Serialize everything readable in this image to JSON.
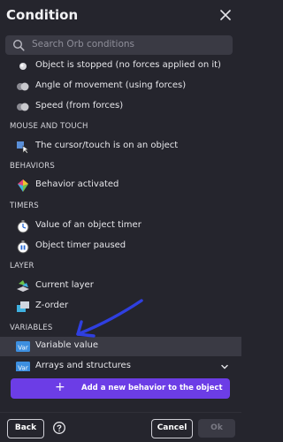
{
  "dialog": {
    "title": "Condition",
    "close_icon": "close-icon"
  },
  "search": {
    "placeholder": "Search Orb conditions",
    "icon": "search-icon"
  },
  "list": {
    "items_top": [
      {
        "label": "Object is stopped (no forces applied on it)",
        "icon": "stopped-icon"
      },
      {
        "label": "Angle of movement (using forces)",
        "icon": "forces-icon"
      },
      {
        "label": "Speed (from forces)",
        "icon": "forces-icon"
      }
    ],
    "groups": [
      {
        "name": "MOUSE AND TOUCH",
        "items": [
          {
            "label": "The cursor/touch is on an object",
            "icon": "cursor-icon"
          }
        ]
      },
      {
        "name": "BEHAVIORS",
        "items": [
          {
            "label": "Behavior activated",
            "icon": "behavior-icon"
          }
        ]
      },
      {
        "name": "TIMERS",
        "items": [
          {
            "label": "Value of an object timer",
            "icon": "timer-icon"
          },
          {
            "label": "Object timer paused",
            "icon": "timer-paused-icon"
          }
        ]
      },
      {
        "name": "LAYER",
        "items": [
          {
            "label": "Current layer",
            "icon": "layer-icon"
          },
          {
            "label": "Z-order",
            "icon": "z-order-icon"
          }
        ]
      },
      {
        "name": "VARIABLES",
        "items": [
          {
            "label": "Variable value",
            "icon": "var-icon",
            "selected": true
          },
          {
            "label": "Arrays and structures",
            "icon": "var-icon",
            "expandable": true
          }
        ]
      }
    ]
  },
  "var_icon_text": "Var",
  "add_behavior": {
    "label": "Add a new behavior to the object",
    "icon": "plus-icon"
  },
  "footer": {
    "back_label": "Back",
    "help_icon": "help-icon",
    "cancel_label": "Cancel",
    "ok_label": "Ok"
  },
  "colors": {
    "background": "#25252d",
    "accent": "#6c3de6",
    "annotation": "#2f3fe0",
    "selected_row": "#3a3a44"
  }
}
